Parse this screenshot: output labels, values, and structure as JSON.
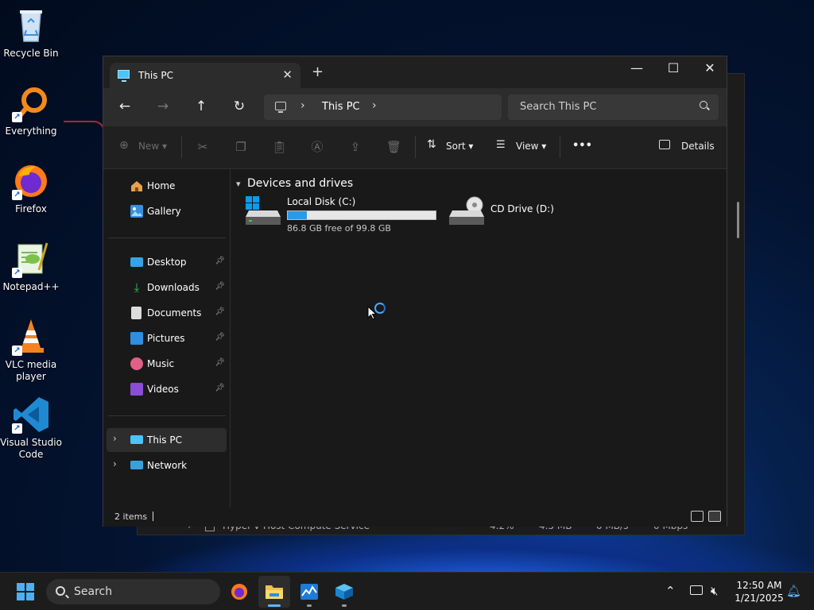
{
  "desktop": {
    "icons": [
      {
        "label": "Recycle Bin"
      },
      {
        "label": "Everything"
      },
      {
        "label": "Firefox"
      },
      {
        "label": "Notepad++"
      },
      {
        "label": "VLC media player"
      },
      {
        "label": "Visual Studio Code"
      }
    ]
  },
  "background_window": {
    "row": {
      "name": "Hyper-V Host Compute Service",
      "cpu": "4.2%",
      "memory": "4.5 MB",
      "disk": "0 MB/s",
      "network": "0 Mbps"
    }
  },
  "explorer": {
    "tab": {
      "title": "This PC"
    },
    "nav": {
      "breadcrumb": "This PC",
      "search_placeholder": "Search This PC"
    },
    "commands": {
      "new_label": "New",
      "sort_label": "Sort",
      "view_label": "View",
      "more_label": "•••",
      "details_label": "Details"
    },
    "sidebar": {
      "quick": [
        {
          "label": "Home"
        },
        {
          "label": "Gallery"
        }
      ],
      "pinned": [
        {
          "label": "Desktop"
        },
        {
          "label": "Downloads"
        },
        {
          "label": "Documents"
        },
        {
          "label": "Pictures"
        },
        {
          "label": "Music"
        },
        {
          "label": "Videos"
        }
      ],
      "locations": [
        {
          "label": "This PC"
        },
        {
          "label": "Network"
        }
      ]
    },
    "content": {
      "group_header": "Devices and drives",
      "drives": [
        {
          "name": "Local Disk (C:)",
          "free_text": "86.8 GB free of 99.8 GB",
          "used_fraction": 0.13
        },
        {
          "name": "CD Drive (D:)"
        }
      ]
    },
    "status": {
      "item_count": "2 items"
    }
  },
  "taskbar": {
    "search_placeholder": "Search",
    "clock": {
      "time": "12:50 AM",
      "date": "1/21/2025"
    }
  },
  "colors": {
    "accent": "#4cc2ff",
    "drive_fill": "#2f98e3",
    "window_bg": "#191919"
  }
}
